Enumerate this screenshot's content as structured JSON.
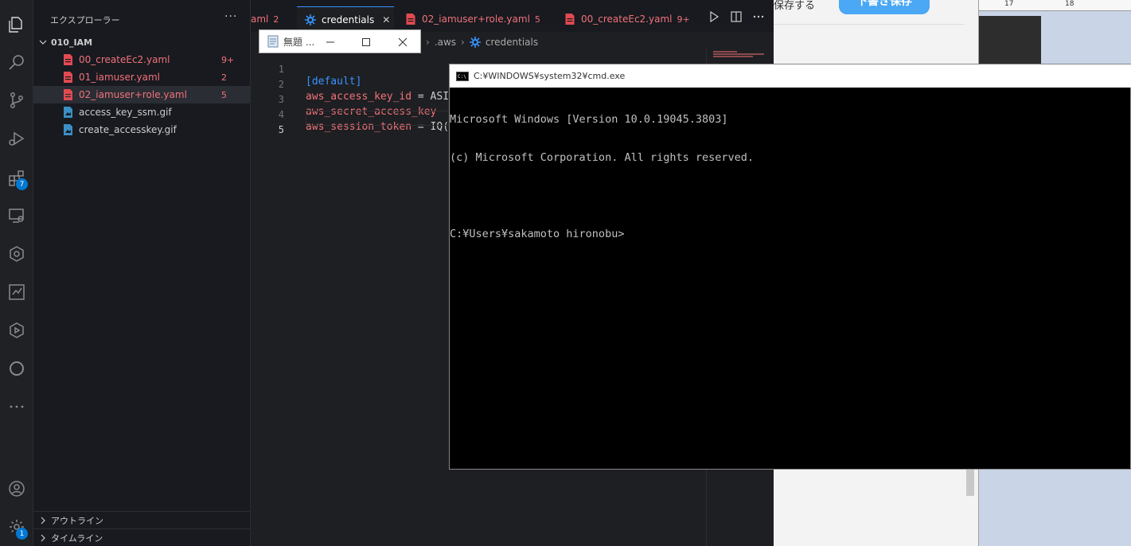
{
  "explorer": {
    "title": "エクスプローラー",
    "more": "···",
    "folder": "010_IAM",
    "files": [
      {
        "name": "00_createEc2.yaml",
        "badge": "9+",
        "status": "error",
        "type": "yaml"
      },
      {
        "name": "01_iamuser.yaml",
        "badge": "2",
        "status": "error",
        "type": "yaml"
      },
      {
        "name": "02_iamuser+role.yaml",
        "badge": "5",
        "status": "error",
        "type": "yaml",
        "selected": true
      },
      {
        "name": "access_key_ssm.gif",
        "badge": "",
        "status": "ok",
        "type": "image"
      },
      {
        "name": "create_accesskey.gif",
        "badge": "",
        "status": "ok",
        "type": "image"
      }
    ],
    "outline": "アウトライン",
    "timeline": "タイムライン"
  },
  "activity_bar": {
    "extensions_badge": "7",
    "settings_badge": "1"
  },
  "tabs": [
    {
      "name": "aml",
      "badge": "2"
    },
    {
      "name": "credentials",
      "badge": "",
      "active": true
    },
    {
      "name": "02_iamuser+role.yaml",
      "badge": "5"
    },
    {
      "name": "00_createEc2.yaml",
      "badge": "9+"
    }
  ],
  "breadcrumb": {
    "folder": ".aws",
    "file": "credentials"
  },
  "code": {
    "lines": [
      {
        "num": "1",
        "section": "[default]"
      },
      {
        "num": "2",
        "key": "aws_access_key_id",
        "op": " = ",
        "val": "ASI"
      },
      {
        "num": "3",
        "key": "aws_secret_access_key",
        "op": " ",
        "val": ""
      },
      {
        "num": "4",
        "key": "aws_session_token",
        "op": " = ",
        "val": "IQ("
      },
      {
        "num": "5"
      }
    ]
  },
  "notepad": {
    "title": "無題 ..."
  },
  "cmd": {
    "title": "C:¥WINDOWS¥system32¥cmd.exe",
    "line1": "Microsoft Windows [Version 10.0.19045.3803]",
    "line2": "(c) Microsoft Corporation. All rights reserved.",
    "line3": "",
    "line4": "C:¥Users¥sakamoto hironobu>"
  },
  "background_app": {
    "text": "保存する",
    "button": "下書き保存",
    "ruler_17": "17",
    "ruler_18": "18"
  },
  "colors": {
    "error": "#f0727a",
    "accent": "#3794ff",
    "badge": "#0078d4"
  }
}
